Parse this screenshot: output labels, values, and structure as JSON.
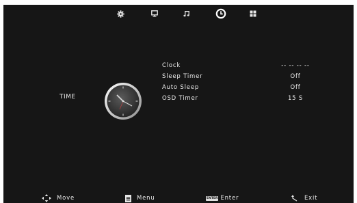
{
  "tabs": [
    {
      "name": "picture",
      "icon": "gear-icon",
      "active": false
    },
    {
      "name": "screen",
      "icon": "monitor-icon",
      "active": false
    },
    {
      "name": "sound",
      "icon": "music-note-icon",
      "active": false
    },
    {
      "name": "time",
      "icon": "clock-icon",
      "active": true
    },
    {
      "name": "option",
      "icon": "grid-icon",
      "active": false
    }
  ],
  "section": {
    "title": "TIME",
    "icon": "analog-clock-icon"
  },
  "menu": {
    "items": [
      {
        "label": "Clock",
        "value": "-- -- -- --"
      },
      {
        "label": "Sleep Timer",
        "value": "Off"
      },
      {
        "label": "Auto Sleep",
        "value": "Off"
      },
      {
        "label": "OSD Timer",
        "value": "15 S"
      }
    ]
  },
  "footer": {
    "move": {
      "label": "Move",
      "icon": "arrows-icon"
    },
    "menu": {
      "label": "Menu",
      "icon": "menu-doc-icon"
    },
    "enter": {
      "label": "Enter",
      "key": "ENTER",
      "icon": "enter-key-icon"
    },
    "exit": {
      "label": "Exit",
      "icon": "return-icon"
    }
  },
  "colors": {
    "background": "#161616",
    "text": "#e6e6e6"
  }
}
